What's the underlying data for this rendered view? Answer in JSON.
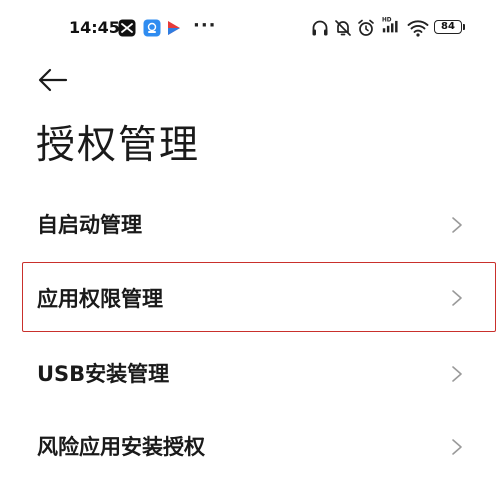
{
  "status_bar": {
    "time": "14:45",
    "dots": "···",
    "battery": "84",
    "icons": [
      "capcut-icon",
      "app-store-icon",
      "play-icon",
      "headphones-icon",
      "mute-alarm-icon",
      "alarm-icon",
      "hd-signal-icon",
      "wifi-icon",
      "battery-icon"
    ]
  },
  "header": {
    "back_icon": "arrow-left-icon",
    "title": "授权管理"
  },
  "menu": {
    "items": [
      {
        "label": "自启动管理"
      },
      {
        "label": "应用权限管理"
      },
      {
        "label": "USB安装管理"
      },
      {
        "label": "风险应用安装授权"
      }
    ],
    "highlight_color": "#c9302c"
  }
}
